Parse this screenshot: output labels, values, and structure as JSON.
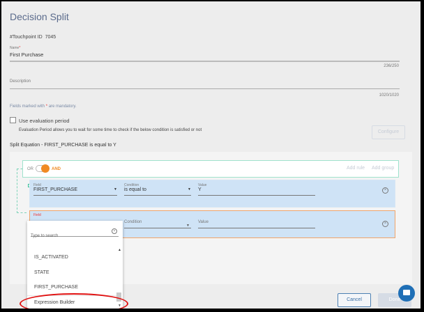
{
  "title": "Decision Split",
  "touchpoint": {
    "label": "#Touchpoint ID",
    "value": "7045"
  },
  "name": {
    "label": "Name",
    "required": "*",
    "value": "First Purchase",
    "counter": "236/250"
  },
  "description": {
    "label": "Description",
    "value": "",
    "counter": "1020/1020"
  },
  "mandatory_note": {
    "prefix": "Fields marked with",
    "star": "*",
    "suffix": "are mandatory."
  },
  "evaluation": {
    "checkbox_label": "Use evaluation period",
    "checked": false,
    "help": "Evaluation Period allows you to wait for some time to check if the below condition is satisfied or not",
    "configure_label": "Configure"
  },
  "split_equation": "Split Equation - FIRST_PURCHASE is equal to Y",
  "group": {
    "or_label": "OR",
    "and_label": "AND",
    "add_rule": "Add rule",
    "add_group": "Add group"
  },
  "rules": [
    {
      "field_label": "Field",
      "field": "FIRST_PURCHASE",
      "condition_label": "Condition",
      "condition": "is equal to",
      "value_label": "Value",
      "value": "Y"
    },
    {
      "field_label": "Field",
      "field": "",
      "condition_label": "Condition",
      "condition": "",
      "value_label": "Value",
      "value": ""
    }
  ],
  "dropdown": {
    "search_placeholder": "Type to search",
    "options": [
      "IS_ACTIVATED",
      "STATE",
      "FIRST_PURCHASE",
      "Expression Builder"
    ]
  },
  "footer": {
    "cancel": "Cancel",
    "done": "Done"
  },
  "colors": {
    "accent": "#f08a24",
    "primary": "#1f6fb6",
    "teal": "#9fe2cd",
    "annotation": "#e01010"
  }
}
